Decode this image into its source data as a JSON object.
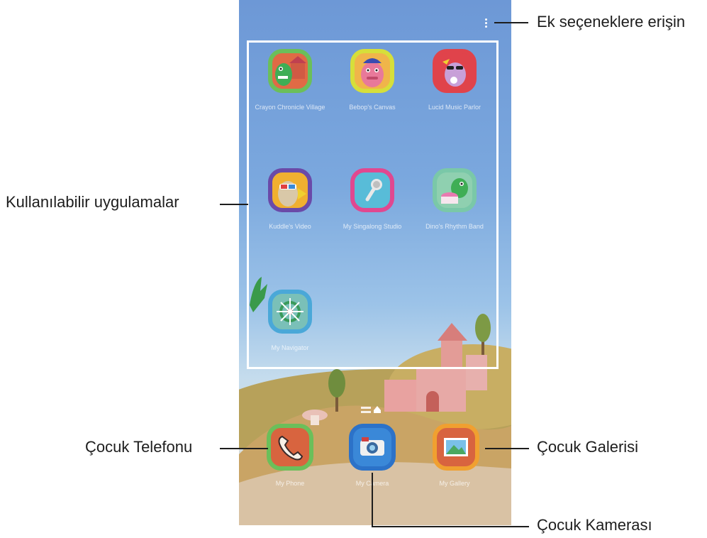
{
  "callouts": {
    "more_options": "Ek seçeneklere erişin",
    "available_apps": "Kullanılabilir uygulamalar",
    "kids_phone": "Çocuk Telefonu",
    "kids_gallery": "Çocuk Galerisi",
    "kids_camera": "Çocuk Kamerası"
  },
  "apps": [
    {
      "icon": "dino-house-icon",
      "border": "#6bbf5a",
      "bg": "#e06a45"
    },
    {
      "icon": "pink-monster-icon",
      "border": "#d6df3a",
      "bg": "#f0b54a"
    },
    {
      "icon": "rockstar-monster-icon",
      "border": "#e0434b",
      "bg": "#e0434b"
    },
    {
      "icon": "3d-glasses-character-icon",
      "border": "#6a4aa8",
      "bg": "#f0b030"
    },
    {
      "icon": "microphone-icon",
      "border": "#e04890",
      "bg": "#58bcd8"
    },
    {
      "icon": "dino-drum-icon",
      "border": "#7ac8a8",
      "bg": "#8fd0b0"
    },
    {
      "icon": "ship-wheel-icon",
      "border": "#4aa8d8",
      "bg": "#7ac0b8"
    }
  ],
  "dock": [
    {
      "icon": "phone-handset-icon",
      "border": "#6bbf5a",
      "bg": "#d8643f"
    },
    {
      "icon": "camera-icon",
      "border": "#2c72c8",
      "bg": "#3a88d8"
    },
    {
      "icon": "gallery-picture-icon",
      "border": "#f0a030",
      "bg": "#d8643f"
    }
  ]
}
